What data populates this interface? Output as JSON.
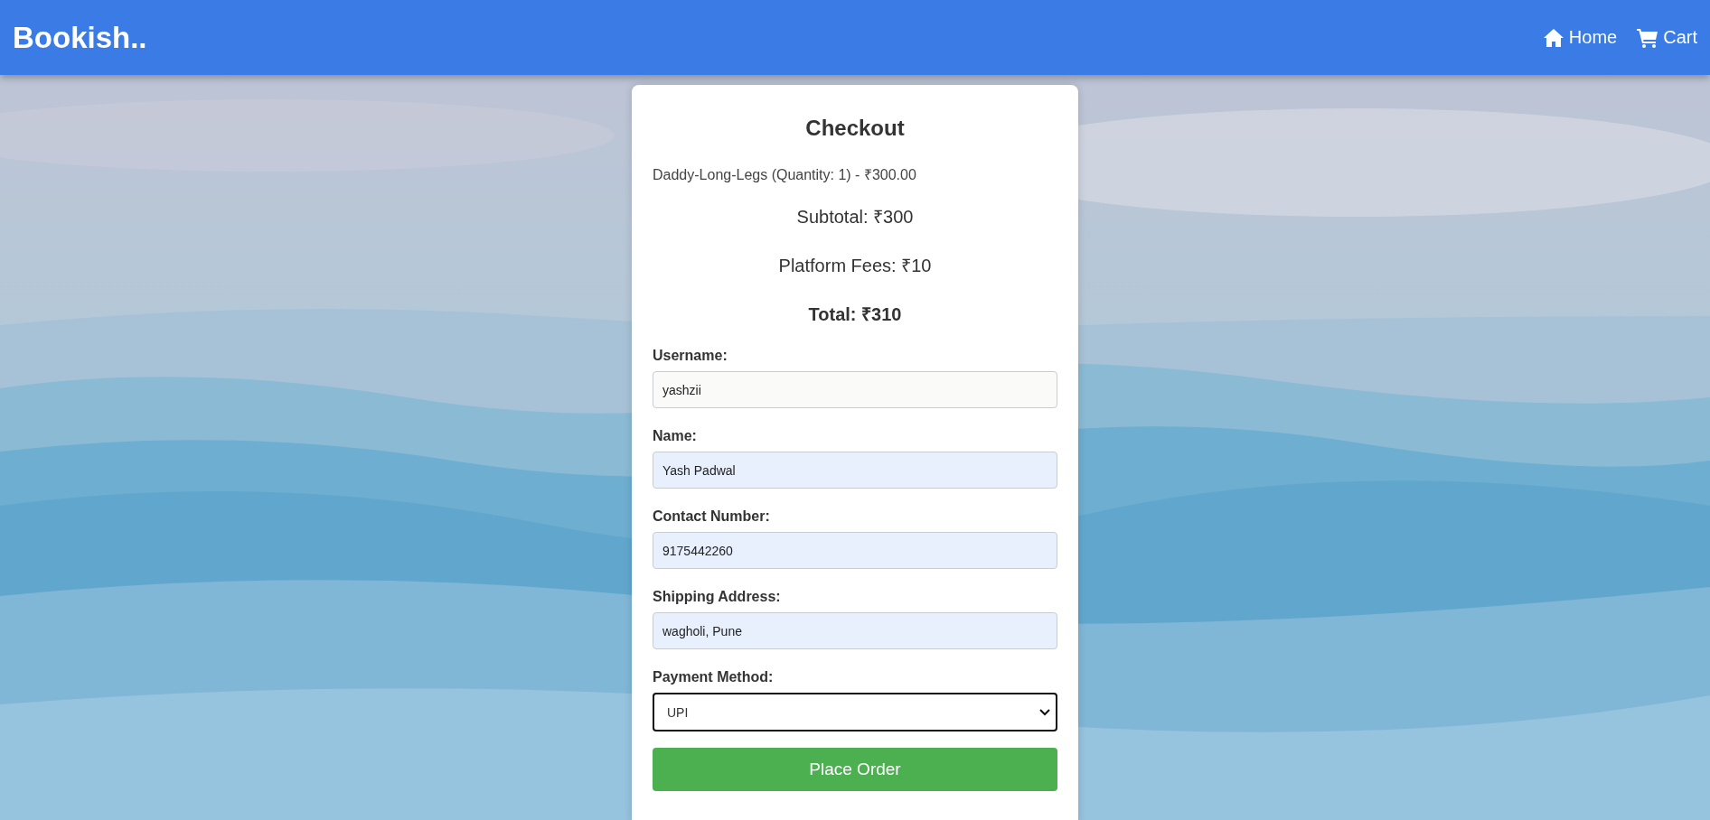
{
  "header": {
    "brand": "Bookish..",
    "nav": [
      {
        "kind": "home",
        "label": "Home"
      },
      {
        "kind": "cart",
        "label": "Cart"
      }
    ]
  },
  "checkout": {
    "title": "Checkout",
    "items": [
      "Daddy-Long-Legs (Quantity: 1) - ₹300.00"
    ],
    "subtotal": "Subtotal: ₹300",
    "fees": "Platform Fees: ₹10",
    "total": "Total: ₹310",
    "fields": [
      {
        "kind": "input",
        "label": "Username:",
        "value": "yashzii",
        "autofilled": false
      },
      {
        "kind": "input",
        "label": "Name:",
        "value": "Yash Padwal",
        "autofilled": true
      },
      {
        "kind": "input",
        "label": "Contact Number:",
        "value": "9175442260",
        "autofilled": true
      },
      {
        "kind": "input",
        "label": "Shipping Address:",
        "value": "wagholi, Pune",
        "autofilled": true
      },
      {
        "kind": "select",
        "label": "Payment Method:",
        "value": "UPI",
        "focused": true
      }
    ],
    "submit": "Place Order"
  }
}
